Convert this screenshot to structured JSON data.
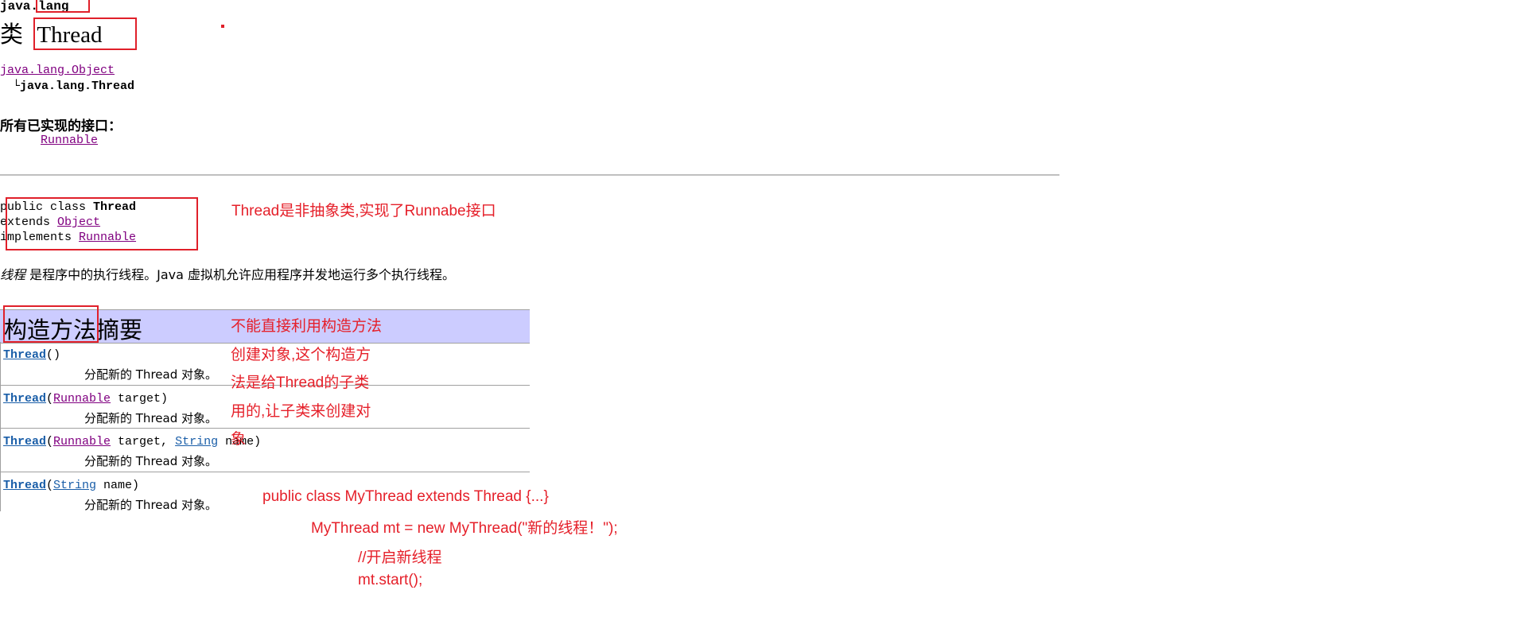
{
  "package_name": "java.lang",
  "class_heading": {
    "prefix": "类",
    "name": "Thread"
  },
  "hierarchy": {
    "parent": "java.lang.Object",
    "child_prefix": "└",
    "child": "java.lang.Thread"
  },
  "interfaces": {
    "label": "所有已实现的接口：",
    "items": [
      "Runnable"
    ]
  },
  "declaration": {
    "line1_prefix": "public class ",
    "line1_name": "Thread",
    "line2_prefix": "extends ",
    "line2_link": "Object",
    "line3_prefix": "implements ",
    "line3_link": "Runnable"
  },
  "description": {
    "italic": "线程",
    "text": " 是程序中的执行线程。Java 虚拟机允许应用程序并发地运行多个执行线程。"
  },
  "constructor_summary": {
    "title": "构造方法摘要",
    "rows": [
      {
        "name": "Thread",
        "params": [],
        "tail": "()",
        "desc": "分配新的 Thread 对象。"
      },
      {
        "name": "Thread",
        "params": [
          {
            "type": "Runnable",
            "text": " target)"
          }
        ],
        "desc": "分配新的 Thread 对象。"
      },
      {
        "name": "Thread",
        "params": [
          {
            "type": "Runnable",
            "text": " target, "
          },
          {
            "type": "String",
            "text": " name)"
          }
        ],
        "desc": "分配新的 Thread 对象。"
      },
      {
        "name": "Thread",
        "params": [
          {
            "type": "String",
            "text": " name)"
          }
        ],
        "desc": "分配新的 Thread 对象。"
      }
    ]
  },
  "annotations": {
    "class_note": "Thread是非抽象类,实现了Runnabe接口",
    "constructor_note_lines": [
      "不能直接利用构造方法",
      "创建对象,这个构造方",
      "法是给Thread的子类",
      "用的,让子类来创建对",
      "象"
    ],
    "code_lines": [
      "public class MyThread extends Thread {...}",
      "MyThread mt = new MyThread(\"新的线程！\");",
      "//开启新线程",
      "mt.start();"
    ]
  },
  "colors": {
    "annotation": "#e5202a",
    "header_band": "#ccccff",
    "visited_link": "#800080",
    "link": "#1a5ea8"
  }
}
